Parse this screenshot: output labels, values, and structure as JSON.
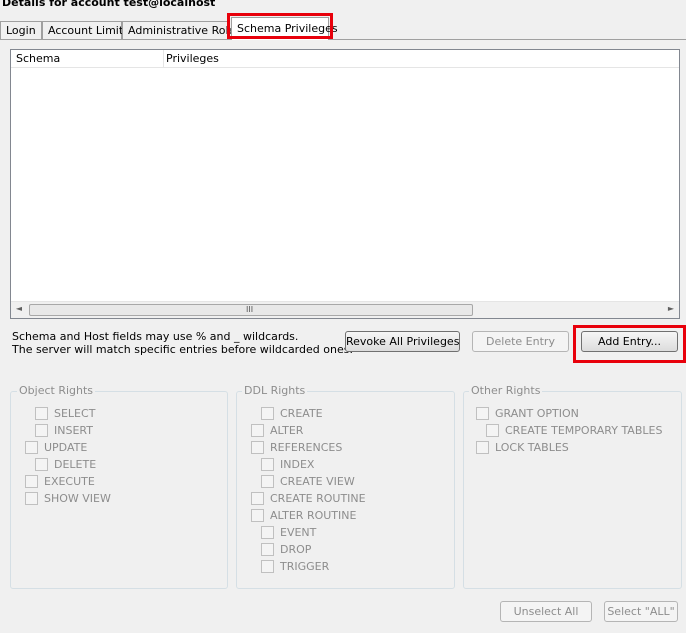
{
  "window": {
    "title": "Details for account test@localhost"
  },
  "tabs": [
    {
      "label": "Login"
    },
    {
      "label": "Account Limits"
    },
    {
      "label": "Administrative Roles"
    },
    {
      "label": "Schema Privileges",
      "active": true
    }
  ],
  "list": {
    "columns": [
      "Schema",
      "Privileges"
    ],
    "scroll_left": "◄",
    "scroll_grip": "III",
    "scroll_right": "►"
  },
  "info": {
    "line1": "Schema and Host fields may use % and _ wildcards.",
    "line2": "The server will match specific entries before wildcarded ones."
  },
  "buttons": {
    "revoke_all": "Revoke All Privileges",
    "delete_entry": "Delete Entry",
    "add_entry": "Add Entry...",
    "unselect_all": "Unselect All",
    "select_all": "Select \"ALL\""
  },
  "groups": {
    "object_rights": {
      "title": "Object Rights",
      "items": [
        "SELECT",
        "INSERT",
        "UPDATE",
        "DELETE",
        "EXECUTE",
        "SHOW VIEW"
      ]
    },
    "ddl_rights": {
      "title": "DDL Rights",
      "items": [
        "CREATE",
        "ALTER",
        "REFERENCES",
        "INDEX",
        "CREATE VIEW",
        "CREATE ROUTINE",
        "ALTER ROUTINE",
        "EVENT",
        "DROP",
        "TRIGGER"
      ]
    },
    "other_rights": {
      "title": "Other Rights",
      "items": [
        "GRANT OPTION",
        "CREATE TEMPORARY TABLES",
        "LOCK TABLES"
      ]
    }
  },
  "colors": {
    "highlight": "#e8000b",
    "disabled_text": "#8d8d8d"
  }
}
